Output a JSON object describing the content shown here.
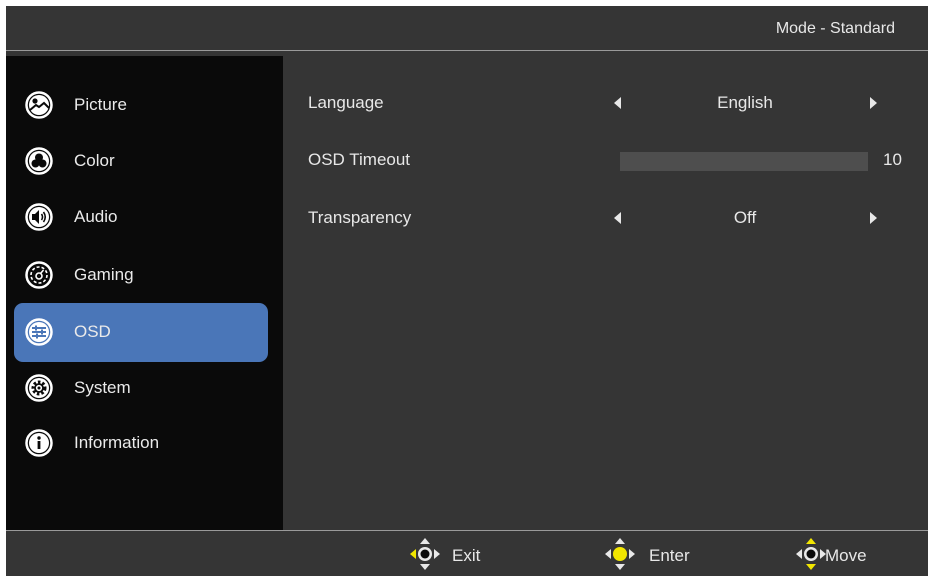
{
  "header": {
    "mode_text": "Mode - Standard"
  },
  "sidebar": {
    "items": [
      {
        "label": "Picture",
        "icon": "picture-icon",
        "active": false
      },
      {
        "label": "Color",
        "icon": "color-icon",
        "active": false
      },
      {
        "label": "Audio",
        "icon": "audio-icon",
        "active": false
      },
      {
        "label": "Gaming",
        "icon": "gaming-icon",
        "active": false
      },
      {
        "label": "OSD",
        "icon": "osd-icon",
        "active": true
      },
      {
        "label": "System",
        "icon": "system-icon",
        "active": false
      },
      {
        "label": "Information",
        "icon": "information-icon",
        "active": false
      }
    ]
  },
  "settings": {
    "language": {
      "label": "Language",
      "value": "English"
    },
    "osd_timeout": {
      "label": "OSD Timeout",
      "value": "10"
    },
    "transparency": {
      "label": "Transparency",
      "value": "Off"
    }
  },
  "footer": {
    "exit": {
      "label": "Exit",
      "icon": "dpad-exit-icon"
    },
    "enter": {
      "label": "Enter",
      "icon": "dpad-enter-icon"
    },
    "move": {
      "label": "Move",
      "icon": "dpad-move-icon"
    }
  },
  "colors": {
    "accent": "#4a76b8",
    "background": "#353535",
    "sidebar": "#0a0a0a",
    "highlight": "#f2e600"
  }
}
